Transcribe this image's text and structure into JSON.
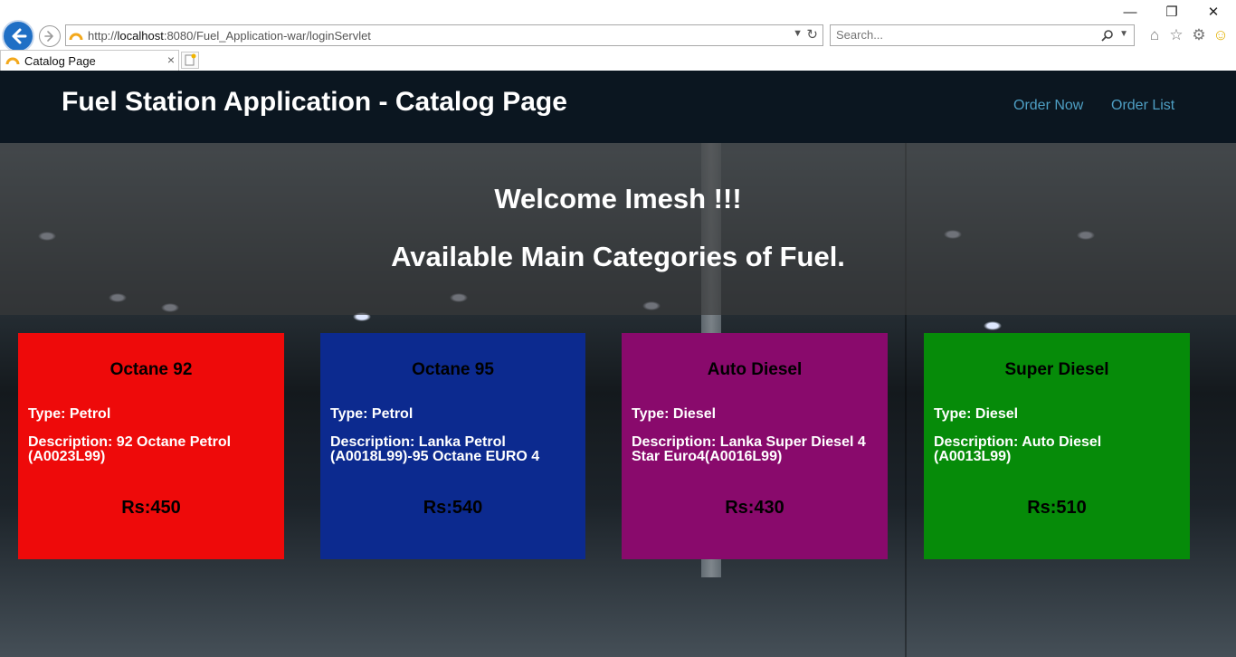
{
  "browser": {
    "url_prefix": "http://",
    "url_host": "localhost",
    "url_rest": ":8080/Fuel_Application-war/loginServlet",
    "search_placeholder": "Search...",
    "tab_title": "Catalog Page",
    "tab_close": "×"
  },
  "header": {
    "title": "Fuel Station Application - Catalog Page",
    "nav": [
      {
        "label": "Order Now"
      },
      {
        "label": "Order List"
      }
    ]
  },
  "hero": {
    "welcome": "Welcome Imesh !!!",
    "subtitle": "Available Main Categories of Fuel."
  },
  "fuels": [
    {
      "name": "Octane 92",
      "type": "Type: Petrol",
      "description": "Description: 92 Octane Petrol (A0023L99)",
      "price": "Rs:450",
      "color": "#ee0a0a"
    },
    {
      "name": "Octane 95",
      "type": "Type: Petrol",
      "description": "Description: Lanka Petrol (A0018L99)-95 Octane EURO 4",
      "price": "Rs:540",
      "color": "#0c2a8f"
    },
    {
      "name": "Auto Diesel",
      "type": "Type: Diesel",
      "description": "Description: Lanka Super Diesel 4 Star Euro4(A0016L99)",
      "price": "Rs:430",
      "color": "#890a6c"
    },
    {
      "name": "Super Diesel",
      "type": "Type: Diesel",
      "description": "Description: Auto Diesel (A0013L99)",
      "price": "Rs:510",
      "color": "#068b09"
    }
  ]
}
